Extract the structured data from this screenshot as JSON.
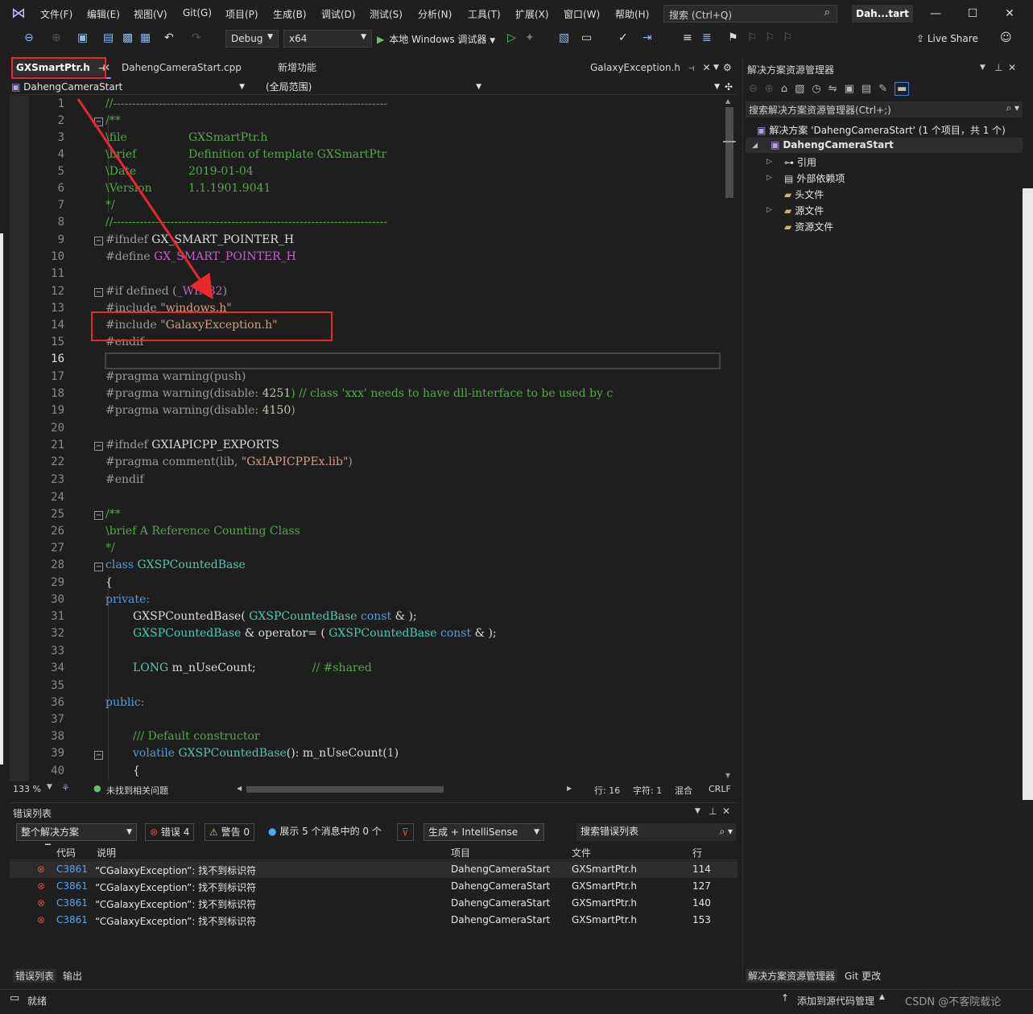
{
  "menubar": {
    "items": [
      "文件(F)",
      "编辑(E)",
      "视图(V)",
      "Git(G)",
      "项目(P)",
      "生成(B)",
      "调试(D)",
      "测试(S)",
      "分析(N)",
      "工具(T)",
      "扩展(X)",
      "窗口(W)",
      "帮助(H)"
    ],
    "search_placeholder": "搜索 (Ctrl+Q)",
    "project_title": "Dah...tart"
  },
  "toolbar": {
    "config": "Debug",
    "platform": "x64",
    "run_label": "本地 Windows 调试器",
    "live_share": "Live Share"
  },
  "tabs": [
    {
      "label": "GXSmartPtr.h",
      "active": true
    },
    {
      "label": "DahengCameraStart.cpp",
      "active": false
    },
    {
      "label": "新增功能",
      "active": false
    },
    {
      "label": "GalaxyException.h",
      "active": false
    }
  ],
  "navbar": {
    "project": "DahengCameraStart",
    "scope": "(全局范围)"
  },
  "editor": {
    "line_numbers": [
      "1",
      "2",
      "3",
      "4",
      "5",
      "6",
      "7",
      "8",
      "9",
      "10",
      "11",
      "12",
      "13",
      "14",
      "15",
      "16",
      "17",
      "18",
      "19",
      "20",
      "21",
      "22",
      "23",
      "24",
      "25",
      "26",
      "27",
      "28",
      "29",
      "30",
      "31",
      "32",
      "33",
      "34",
      "35",
      "36",
      "37",
      "38",
      "39",
      "40"
    ],
    "current_line": "16",
    "lines": {
      "l1": "//------------------------------------------------------------------------",
      "l2": "/**",
      "l3a": "\\file",
      "l3b": "GXSmartPtr.h",
      "l4a": "\\brief",
      "l4b": "Definition of template GXSmartPtr",
      "l5a": "\\Date",
      "l5b": "2019-01-04",
      "l6a": "\\Version",
      "l6b": "1.1.1901.9041",
      "l7": "*/",
      "l8": "//------------------------------------------------------------------------",
      "l9a": "#ifndef",
      "l9b": "GX_SMART_POINTER_H",
      "l10a": "#define",
      "l10b": "GX_SMART_POINTER_H",
      "l12a": "#if defined (",
      "l12b": "_WIN32",
      "l12c": ")",
      "l13a": "#include",
      "l13b": "\"windows.h\"",
      "l14a": "#include",
      "l14b": "\"GalaxyException.h\"",
      "l15": "#endif",
      "l17": "#pragma warning(push)",
      "l18a": "#pragma warning(disable: ",
      "l18b": "4251",
      "l18c": ") // class 'xxx' needs to have dll-interface to be used by c",
      "l19a": "#pragma warning(disable: ",
      "l19b": "4150",
      "l19c": ")",
      "l21a": "#ifndef",
      "l21b": "GXIAPICPP_EXPORTS",
      "l22a": "#pragma comment(lib, ",
      "l22b": "\"GxIAPICPPEx.lib\"",
      "l22c": ")",
      "l23": "#endif",
      "l25": "/**",
      "l26": "\\brief A Reference Counting Class",
      "l27": "*/",
      "l28a": "class",
      "l28b": "GXSPCountedBase",
      "l29": "{",
      "l30": "private:",
      "l31a": "GXSPCountedBase",
      "l31b": "( ",
      "l31c": "GXSPCountedBase",
      "l31d": "const",
      "l31e": "& );",
      "l32a": "GXSPCountedBase",
      "l32b": "& operator= ( ",
      "l32c": "GXSPCountedBase",
      "l32d": "const",
      "l32e": "& );",
      "l34a": "LONG",
      "l34b": "m_nUseCount;",
      "l34c": "// #shared",
      "l36": "public:",
      "l38": "/// Default constructor",
      "l39a": "volatile",
      "l39b": "GXSPCountedBase",
      "l39c": "(): m_nUseCount(",
      "l39d": "1",
      "l39e": ")",
      "l40": "{"
    }
  },
  "editor_status": {
    "zoom": "133 %",
    "issues": "未找到相关问题",
    "line": "行: 16",
    "char": "字符: 1",
    "mode": "混合",
    "eol": "CRLF"
  },
  "solution_explorer": {
    "title": "解决方案资源管理器",
    "search_placeholder": "搜索解决方案资源管理器(Ctrl+;)",
    "solution": "解决方案 'DahengCameraStart' (1 个项目，共 1 个)",
    "project": "DahengCameraStart",
    "items": [
      "引用",
      "外部依赖项",
      "头文件",
      "源文件",
      "资源文件"
    ],
    "bottom_tabs": [
      "解决方案资源管理器",
      "Git 更改"
    ]
  },
  "error_list": {
    "title": "错误列表",
    "scope": "整个解决方案",
    "errors_btn": "错误 4",
    "warnings_btn": "警告 0",
    "messages_btn": "展示 5 个消息中的 0 个",
    "source": "生成 + IntelliSense",
    "search_placeholder": "搜索错误列表",
    "columns": [
      "代码",
      "说明",
      "项目",
      "文件",
      "行"
    ],
    "rows": [
      {
        "code": "C3861",
        "desc": "“CGalaxyException”: 找不到标识符",
        "project": "DahengCameraStart",
        "file": "GXSmartPtr.h",
        "line": "114"
      },
      {
        "code": "C3861",
        "desc": "“CGalaxyException”: 找不到标识符",
        "project": "DahengCameraStart",
        "file": "GXSmartPtr.h",
        "line": "127"
      },
      {
        "code": "C3861",
        "desc": "“CGalaxyException”: 找不到标识符",
        "project": "DahengCameraStart",
        "file": "GXSmartPtr.h",
        "line": "140"
      },
      {
        "code": "C3861",
        "desc": "“CGalaxyException”: 找不到标识符",
        "project": "DahengCameraStart",
        "file": "GXSmartPtr.h",
        "line": "153"
      }
    ],
    "bottom_tabs": [
      "错误列表",
      "输出"
    ]
  },
  "statusbar": {
    "ready": "就绪",
    "add_source": "添加到源代码管理",
    "watermark": "CSDN @不客院载论"
  },
  "colors": {
    "accent": "#9a7ee6",
    "annotation": "#e8282a",
    "error": "#e04646"
  }
}
